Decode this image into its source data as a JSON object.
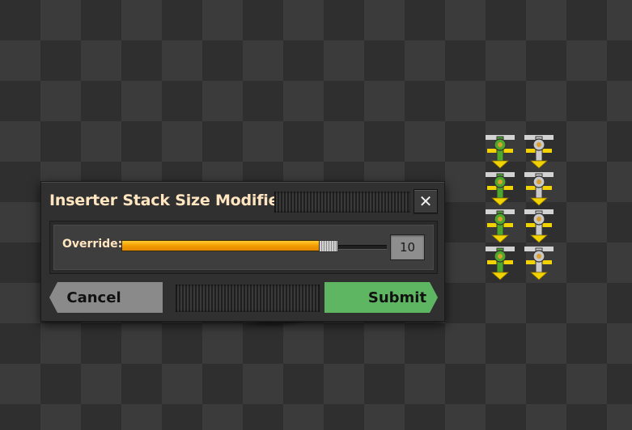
{
  "dialog": {
    "title": "Inserter Stack Size Modifier",
    "close_icon": "close-icon",
    "override": {
      "label": "Override:",
      "value": "10",
      "slider_fill_fraction": 0.78
    },
    "cancel_label": "Cancel",
    "submit_label": "Submit"
  },
  "colors": {
    "title_text": "#ffe6c0",
    "slider_fill": "#f29c00",
    "submit_button": "#5eb663",
    "cancel_button": "#8a8a8a",
    "inserter_green": "#4ea82c",
    "inserter_grey": "#c8c8c8",
    "inserter_arrow": "#f2d200"
  },
  "map": {
    "inserters": [
      {
        "variant": "green",
        "icon": "inserter-icon"
      },
      {
        "variant": "grey",
        "icon": "inserter-icon"
      },
      {
        "variant": "green",
        "icon": "inserter-icon"
      },
      {
        "variant": "grey",
        "icon": "inserter-icon"
      },
      {
        "variant": "green",
        "icon": "inserter-icon"
      },
      {
        "variant": "grey",
        "icon": "inserter-icon"
      },
      {
        "variant": "green",
        "icon": "inserter-icon"
      },
      {
        "variant": "grey",
        "icon": "inserter-icon"
      }
    ]
  }
}
